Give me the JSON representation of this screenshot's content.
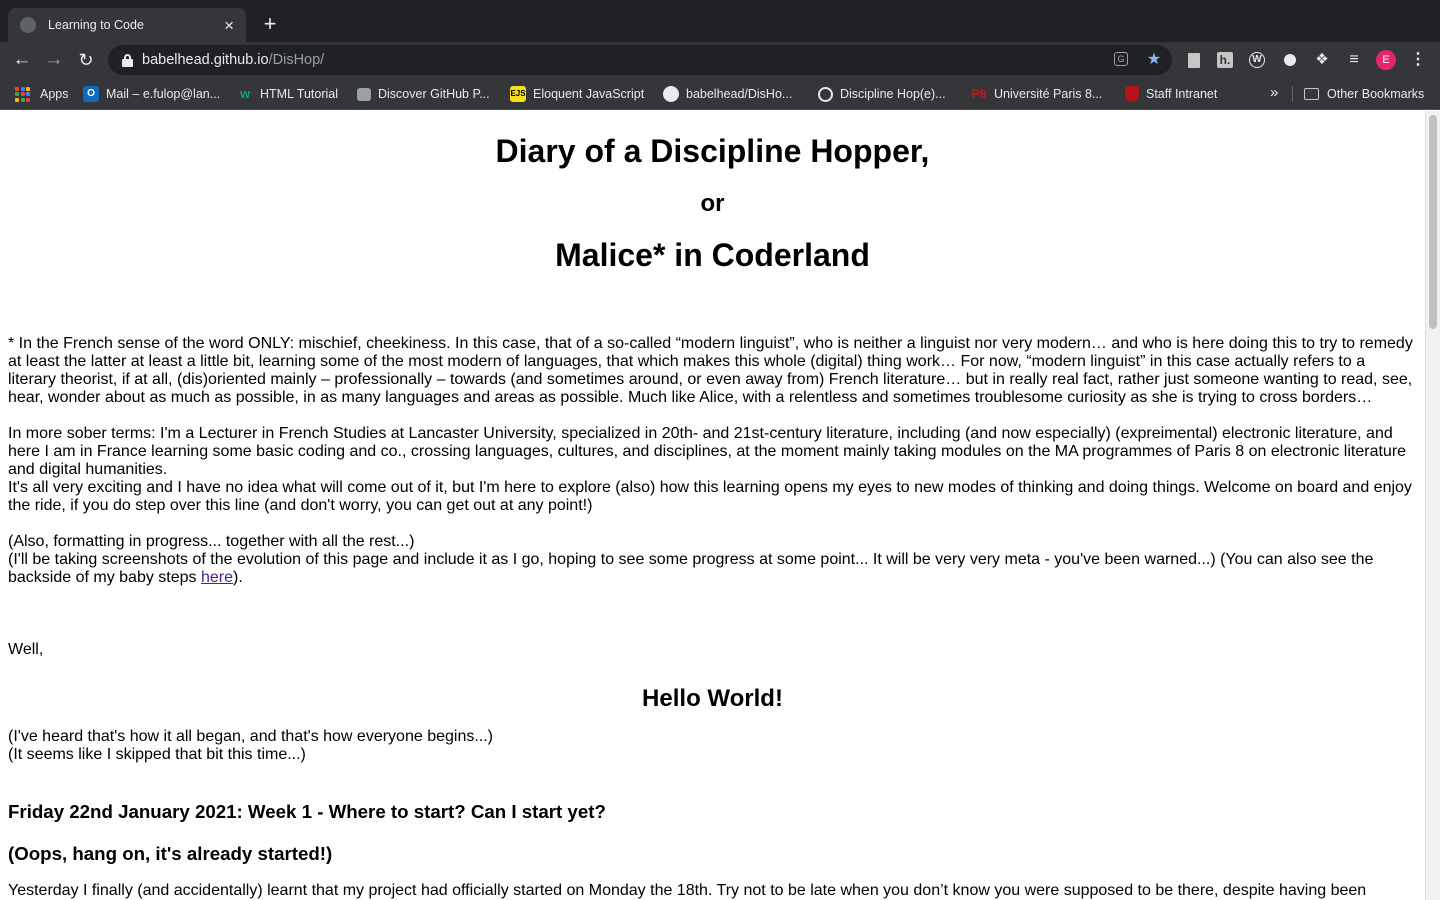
{
  "browser": {
    "tab_title": "Learning to Code",
    "tab_close": "×",
    "new_tab": "+",
    "url_host": "babelhead.github.io",
    "url_path": "/DisHop/",
    "profile_initial": "E",
    "bookmarks": [
      {
        "label": "Apps",
        "icon": "apps-grid-icon"
      },
      {
        "label": "Mail – e.fulop@lan...",
        "icon": "outlook-icon",
        "color": "#0f6cbd"
      },
      {
        "label": "HTML Tutorial",
        "icon": "w3schools-icon",
        "color": "#04aa6d"
      },
      {
        "label": "Discover GitHub P...",
        "icon": "page-icon",
        "color": "#9aa0a6"
      },
      {
        "label": "Eloquent JavaScript",
        "icon": "ejs-icon",
        "color": "#f7df1e"
      },
      {
        "label": "babelhead/DisHo...",
        "icon": "github-icon",
        "color": "#e8eaed"
      },
      {
        "label": "Discipline Hop(e)...",
        "icon": "globe-icon",
        "color": "#e8eaed"
      },
      {
        "label": "Université Paris 8...",
        "icon": "paris8-icon",
        "color": "#c4161c"
      },
      {
        "label": "Staff Intranet",
        "icon": "shield-crest-icon",
        "color": "#b5121b"
      }
    ],
    "other_bookmarks": "Other Bookmarks",
    "more_bookmarks": "»"
  },
  "page": {
    "title": "Diary of a Discipline Hopper,",
    "or": "or",
    "subtitle": "Malice* in Coderland",
    "footnote": "* In the French sense of the word ONLY: mischief, cheekiness. In this case, that of a so-called “modern linguist”, who is neither a linguist nor very modern… and who is here doing this to try to remedy at least the latter at least a little bit, learning some of the most modern of languages, that which makes this whole (digital) thing work… For now, “modern linguist” in this case actually refers to a literary theorist, if at all, (dis)oriented mainly – professionally – towards (and sometimes around, or even away from) French literature… but in really real fact, rather just someone wanting to read, see, hear, wonder about as much as possible, in as many languages and areas as possible. Much like Alice, with a relentless and sometimes troublesome curiosity as she is trying to cross borders…",
    "sober": "In more sober terms: I'm a Lecturer in French Studies at Lancaster University, specialized in 20th- and 21st-century literature, including (and now especially) (expreimental) electronic literature, and here I am in France learning some basic coding and co., crossing languages, cultures, and disciplines, at the moment mainly taking modules on the MA programmes of Paris 8 on electronic literature and digital humanities.",
    "exciting": "It's all very exciting and I have no idea what will come out of it, but I'm here to explore (also) how this learning opens my eyes to new modes of thinking and doing things. Welcome on board and enjoy the ride, if you do step over this line (and don't worry, you can get out at any point!)",
    "formatting": "(Also, formatting in progress... together with all the rest...)",
    "screenshots_before": "(I'll be taking screenshots of the evolution of this page and include it as I go, hoping to see some progress at some point... It will be very very meta - you've been warned...) (You can also see the backside of my baby steps ",
    "here_link": "here",
    "screenshots_after": ").",
    "well": "Well,",
    "hello_world": "Hello World!",
    "heard": "(I've heard that's how it all began, and that's how everyone begins...)",
    "skipped": "(It seems like I skipped that bit this time...)",
    "date_heading": "Friday 22nd January 2021: Week 1 - Where to start? Can I start yet?",
    "oops_heading": "(Oops, hang on, it's already started!)",
    "yesterday": "Yesterday I finally (and accidentally) learnt that my project had officially started on Monday the 18th. Try not to be late when you don’t know you were supposed to be there, despite having been"
  }
}
